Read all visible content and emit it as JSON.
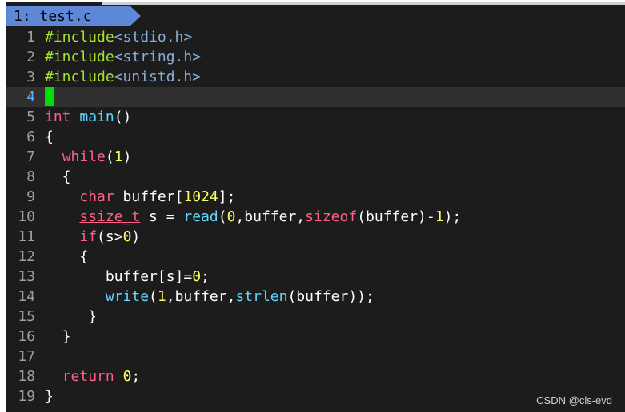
{
  "tabline": {
    "tab_label": "1: test.c"
  },
  "colors": {
    "background": "#1c1c1c",
    "tab": "#5f87d7",
    "preprocessor": "#a6e22e",
    "include_path": "#87afd7",
    "keyword": "#ff5f87",
    "function": "#5fd7ff",
    "number": "#ffff5f",
    "cursor": "#00e000",
    "current_line_number": "#5fafff"
  },
  "editor": {
    "current_line": 4,
    "lines": [
      {
        "n": "1",
        "segs": [
          [
            "#include",
            "pre"
          ],
          [
            "<stdio.h>",
            "inc"
          ]
        ]
      },
      {
        "n": "2",
        "segs": [
          [
            "#include",
            "pre"
          ],
          [
            "<string.h>",
            "inc"
          ]
        ]
      },
      {
        "n": "3",
        "segs": [
          [
            "#include",
            "pre"
          ],
          [
            "<unistd.h>",
            "inc"
          ]
        ]
      },
      {
        "n": "4",
        "segs": [
          [
            "",
            "cursor"
          ]
        ]
      },
      {
        "n": "5",
        "segs": [
          [
            "int",
            "type"
          ],
          [
            " ",
            ""
          ],
          [
            "main",
            "fn"
          ],
          [
            "()",
            ""
          ]
        ]
      },
      {
        "n": "6",
        "segs": [
          [
            "{",
            ""
          ]
        ]
      },
      {
        "n": "7",
        "segs": [
          [
            "  ",
            ""
          ],
          [
            "while",
            "kw"
          ],
          [
            "(",
            ""
          ],
          [
            "1",
            "num"
          ],
          [
            ")",
            ""
          ]
        ]
      },
      {
        "n": "8",
        "segs": [
          [
            "  {",
            ""
          ]
        ]
      },
      {
        "n": "9",
        "segs": [
          [
            "    ",
            ""
          ],
          [
            "char",
            "type"
          ],
          [
            " buffer[",
            ""
          ],
          [
            "1024",
            "num"
          ],
          [
            "];",
            ""
          ]
        ]
      },
      {
        "n": "10",
        "segs": [
          [
            "    ",
            ""
          ],
          [
            "ssize_t",
            "type ul"
          ],
          [
            " s = ",
            ""
          ],
          [
            "read",
            "fn"
          ],
          [
            "(",
            ""
          ],
          [
            "0",
            "num"
          ],
          [
            ",buffer,",
            ""
          ],
          [
            "sizeof",
            "kw"
          ],
          [
            "(buffer)-",
            ""
          ],
          [
            "1",
            "num"
          ],
          [
            ");",
            ""
          ]
        ]
      },
      {
        "n": "11",
        "segs": [
          [
            "    ",
            ""
          ],
          [
            "if",
            "kw"
          ],
          [
            "(s>",
            ""
          ],
          [
            "0",
            "num"
          ],
          [
            ")",
            ""
          ]
        ]
      },
      {
        "n": "12",
        "segs": [
          [
            "    {",
            ""
          ]
        ]
      },
      {
        "n": "13",
        "segs": [
          [
            "       buffer[s]=",
            ""
          ],
          [
            "0",
            "num"
          ],
          [
            ";",
            ""
          ]
        ]
      },
      {
        "n": "14",
        "segs": [
          [
            "       ",
            ""
          ],
          [
            "write",
            "fn"
          ],
          [
            "(",
            ""
          ],
          [
            "1",
            "num"
          ],
          [
            ",buffer,",
            ""
          ],
          [
            "strlen",
            "fn"
          ],
          [
            "(buffer));",
            ""
          ]
        ]
      },
      {
        "n": "15",
        "segs": [
          [
            "     }",
            ""
          ]
        ]
      },
      {
        "n": "16",
        "segs": [
          [
            "  }",
            ""
          ]
        ]
      },
      {
        "n": "17",
        "segs": []
      },
      {
        "n": "18",
        "segs": [
          [
            "  ",
            ""
          ],
          [
            "return",
            "kw"
          ],
          [
            " ",
            ""
          ],
          [
            "0",
            "num"
          ],
          [
            ";",
            ""
          ]
        ]
      },
      {
        "n": "19",
        "segs": [
          [
            "}",
            ""
          ]
        ]
      }
    ]
  },
  "watermark": "CSDN @cls-evd"
}
